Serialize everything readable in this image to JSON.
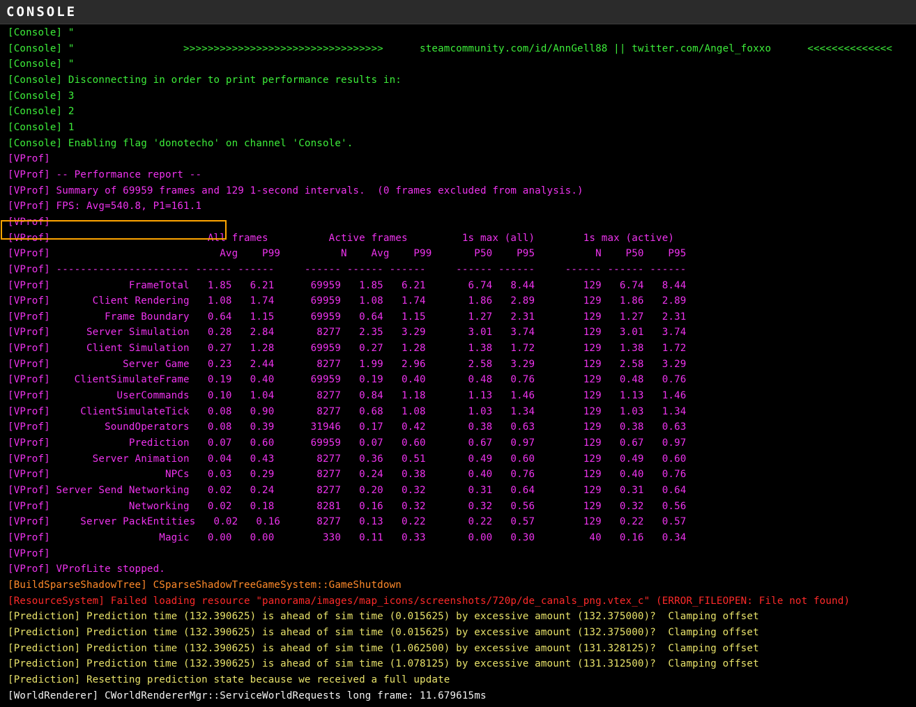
{
  "window": {
    "title": "CONSOLE"
  },
  "colors": {
    "console": "#3ded3a",
    "vprof": "#ee33ee",
    "buildsparse": "#ff8a2a",
    "resource": "#ff2a2a",
    "prediction": "#e8e26a",
    "worldrenderer": "#f2f2f2",
    "highlight": "#ffa500"
  },
  "lines": [
    {
      "cat": "console",
      "text": "[Console] \""
    },
    {
      "cat": "console",
      "text": "[Console] \"                  >>>>>>>>>>>>>>>>>>>>>>>>>>>>>>>>>      steamcommunity.com/id/AnnGell88 || twitter.com/Angel_foxxo      <<<<<<<<<<<<<<"
    },
    {
      "cat": "console",
      "text": "[Console] \""
    },
    {
      "cat": "console",
      "text": "[Console] Disconnecting in order to print performance results in:"
    },
    {
      "cat": "console",
      "text": "[Console] 3"
    },
    {
      "cat": "console",
      "text": "[Console] 2"
    },
    {
      "cat": "console",
      "text": "[Console] 1"
    },
    {
      "cat": "console",
      "text": "[Console] Enabling flag 'donotecho' on channel 'Console'."
    },
    {
      "cat": "vprof",
      "text": "[VProf]"
    },
    {
      "cat": "vprof",
      "text": "[VProf] -- Performance report --"
    },
    {
      "cat": "vprof",
      "text": "[VProf] Summary of 69959 frames and 129 1-second intervals.  (0 frames excluded from analysis.)"
    },
    {
      "cat": "vprof",
      "text": "[VProf] FPS: Avg=540.8, P1=161.1"
    },
    {
      "cat": "vprof",
      "text": "[VProf]"
    },
    {
      "cat": "vprof",
      "text": "[VProf]                          All frames          Active frames         1s max (all)        1s max (active)"
    },
    {
      "cat": "vprof",
      "text": "[VProf]                            Avg    P99          N    Avg    P99       P50    P95          N    P50    P95"
    },
    {
      "cat": "vprof",
      "text": "[VProf] ---------------------- ------ ------     ------ ------ ------     ------ ------     ------ ------ ------"
    },
    {
      "cat": "vprof",
      "text": "[VProf]             FrameTotal   1.85   6.21      69959   1.85   6.21       6.74   8.44        129   6.74   8.44"
    },
    {
      "cat": "vprof",
      "text": "[VProf]       Client Rendering   1.08   1.74      69959   1.08   1.74       1.86   2.89        129   1.86   2.89"
    },
    {
      "cat": "vprof",
      "text": "[VProf]         Frame Boundary   0.64   1.15      69959   0.64   1.15       1.27   2.31        129   1.27   2.31"
    },
    {
      "cat": "vprof",
      "text": "[VProf]      Server Simulation   0.28   2.84       8277   2.35   3.29       3.01   3.74        129   3.01   3.74"
    },
    {
      "cat": "vprof",
      "text": "[VProf]      Client Simulation   0.27   1.28      69959   0.27   1.28       1.38   1.72        129   1.38   1.72"
    },
    {
      "cat": "vprof",
      "text": "[VProf]            Server Game   0.23   2.44       8277   1.99   2.96       2.58   3.29        129   2.58   3.29"
    },
    {
      "cat": "vprof",
      "text": "[VProf]    ClientSimulateFrame   0.19   0.40      69959   0.19   0.40       0.48   0.76        129   0.48   0.76"
    },
    {
      "cat": "vprof",
      "text": "[VProf]           UserCommands   0.10   1.04       8277   0.84   1.18       1.13   1.46        129   1.13   1.46"
    },
    {
      "cat": "vprof",
      "text": "[VProf]     ClientSimulateTick   0.08   0.90       8277   0.68   1.08       1.03   1.34        129   1.03   1.34"
    },
    {
      "cat": "vprof",
      "text": "[VProf]         SoundOperators   0.08   0.39      31946   0.17   0.42       0.38   0.63        129   0.38   0.63"
    },
    {
      "cat": "vprof",
      "text": "[VProf]             Prediction   0.07   0.60      69959   0.07   0.60       0.67   0.97        129   0.67   0.97"
    },
    {
      "cat": "vprof",
      "text": "[VProf]       Server Animation   0.04   0.43       8277   0.36   0.51       0.49   0.60        129   0.49   0.60"
    },
    {
      "cat": "vprof",
      "text": "[VProf]                   NPCs   0.03   0.29       8277   0.24   0.38       0.40   0.76        129   0.40   0.76"
    },
    {
      "cat": "vprof",
      "text": "[VProf] Server Send Networking   0.02   0.24       8277   0.20   0.32       0.31   0.64        129   0.31   0.64"
    },
    {
      "cat": "vprof",
      "text": "[VProf]             Networking   0.02   0.18       8281   0.16   0.32       0.32   0.56        129   0.32   0.56"
    },
    {
      "cat": "vprof",
      "text": "[VProf]     Server PackEntities   0.02   0.16      8277   0.13   0.22       0.22   0.57        129   0.22   0.57"
    },
    {
      "cat": "vprof",
      "text": "[VProf]                  Magic   0.00   0.00        330   0.11   0.33       0.00   0.30         40   0.16   0.34"
    },
    {
      "cat": "vprof",
      "text": "[VProf]"
    },
    {
      "cat": "vprof",
      "text": "[VProf] VProfLite stopped."
    },
    {
      "cat": "buildsparse",
      "text": "[BuildSparseShadowTree] CSparseShadowTreeGameSystem::GameShutdown"
    },
    {
      "cat": "resource",
      "text": "[ResourceSystem] Failed loading resource \"panorama/images/map_icons/screenshots/720p/de_canals_png.vtex_c\" (ERROR_FILEOPEN: File not found)"
    },
    {
      "cat": "prediction",
      "text": "[Prediction] Prediction time (132.390625) is ahead of sim time (0.015625) by excessive amount (132.375000)?  Clamping offset"
    },
    {
      "cat": "prediction",
      "text": "[Prediction] Prediction time (132.390625) is ahead of sim time (0.015625) by excessive amount (132.375000)?  Clamping offset"
    },
    {
      "cat": "prediction",
      "text": "[Prediction] Prediction time (132.390625) is ahead of sim time (1.062500) by excessive amount (131.328125)?  Clamping offset"
    },
    {
      "cat": "prediction",
      "text": "[Prediction] Prediction time (132.390625) is ahead of sim time (1.078125) by excessive amount (131.312500)?  Clamping offset"
    },
    {
      "cat": "prediction",
      "text": "[Prediction] Resetting prediction state because we received a full update"
    },
    {
      "cat": "worldrenderer",
      "text": "[WorldRenderer] CWorldRendererMgr::ServiceWorldRequests long frame: 11.679615ms"
    }
  ]
}
